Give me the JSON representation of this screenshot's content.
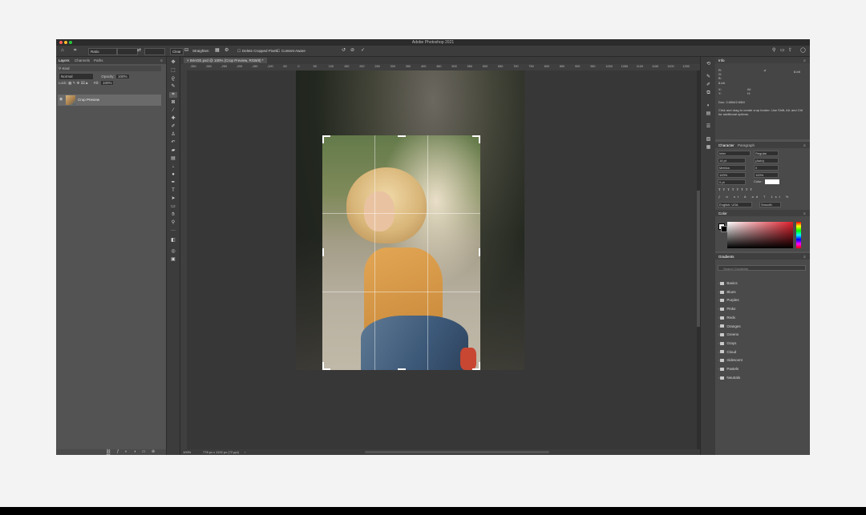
{
  "app": {
    "title": "Adobe Photoshop 2021"
  },
  "options_bar": {
    "ratio_value": "Ratio",
    "clear_label": "Clear",
    "straighten_label": "Straighten",
    "delete_cropped_label": "Delete Cropped Pixels",
    "content_aware_label": "Content-Aware"
  },
  "layers_panel": {
    "tabs": [
      "Layers",
      "Channels",
      "Paths"
    ],
    "kind_label": "Kind",
    "blend_mode": "Normal",
    "opacity_label": "Opacity:",
    "opacity_value": "100%",
    "lock_label": "Lock:",
    "fill_label": "Fill:",
    "fill_value": "100%",
    "layer_name": "Crop Preview"
  },
  "document": {
    "tab_label": "IMAGE.psd @ 100% (Crop Preview, RGB/8) *",
    "ruler_labels": [
      "-350",
      "-300",
      "-250",
      "-200",
      "-150",
      "-100",
      "-50",
      "0",
      "50",
      "100",
      "150",
      "200",
      "250",
      "300",
      "350",
      "400",
      "450",
      "500",
      "550",
      "600",
      "650",
      "700",
      "750",
      "800",
      "850",
      "900",
      "950",
      "1000",
      "1050",
      "1100",
      "1150",
      "1200",
      "1250"
    ]
  },
  "status": {
    "zoom": "100%",
    "doc_info": "778 px x 1192 px (72 ppi)"
  },
  "info_panel": {
    "tab": "Info",
    "r_label": "R:",
    "g_label": "G:",
    "b_label": "B:",
    "bit_label": "8-bit",
    "x_label": "X:",
    "y_label": "Y:",
    "w_label": "W:",
    "h_label": "H:",
    "doc_label": "Doc: 2.65M/2.65M",
    "hint": "Click and drag to create crop border. Use Shift, Alt, and Ctrl for additional options."
  },
  "character_panel": {
    "tabs": [
      "Character",
      "Paragraph"
    ],
    "font_family": "Inter",
    "font_style": "Regular",
    "font_size": "14 pt",
    "leading": "(Auto)",
    "tracking": "0",
    "kerning": "Metrics",
    "vscale": "100%",
    "hscale": "100%",
    "baseline": "0 pt",
    "color_label": "Color:",
    "language": "English: USA",
    "aa": "Smooth"
  },
  "color_panel": {
    "tab": "Color"
  },
  "gradients_panel": {
    "tab": "Gradients",
    "search_placeholder": "Search Gradients",
    "folders": [
      "Basics",
      "Blues",
      "Purples",
      "Pinks",
      "Reds",
      "Oranges",
      "Greens",
      "Grays",
      "Cloud",
      "Iridescent",
      "Pastels",
      "Neutrals"
    ]
  },
  "colors": {
    "panel_bg": "#535353",
    "canvas_bg": "#373737",
    "titlebar": "#2b2b2b",
    "shirt": "#e2a655"
  }
}
